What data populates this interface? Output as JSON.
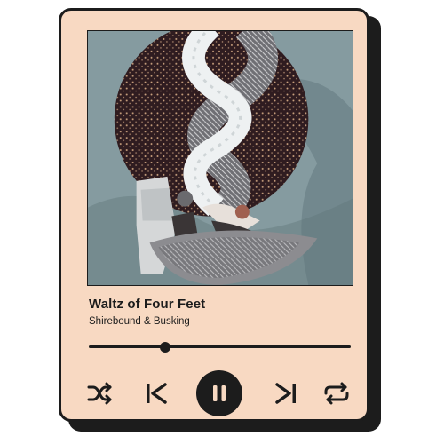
{
  "player": {
    "track_title": "Waltz of Four Feet",
    "artist": "Shirebound & Busking",
    "progress_fraction": 0.29,
    "state": "playing",
    "artwork": {
      "description_icon": "collage-album-art-icon"
    },
    "controls": {
      "shuffle_icon": "shuffle-icon",
      "previous_icon": "skip-previous-icon",
      "play_pause_icon": "pause-icon",
      "next_icon": "skip-next-icon",
      "repeat_icon": "repeat-icon"
    }
  },
  "colors": {
    "card_background": "#f8d9c2",
    "ink": "#1c1c1c",
    "shadow": "#1c1c1c"
  }
}
